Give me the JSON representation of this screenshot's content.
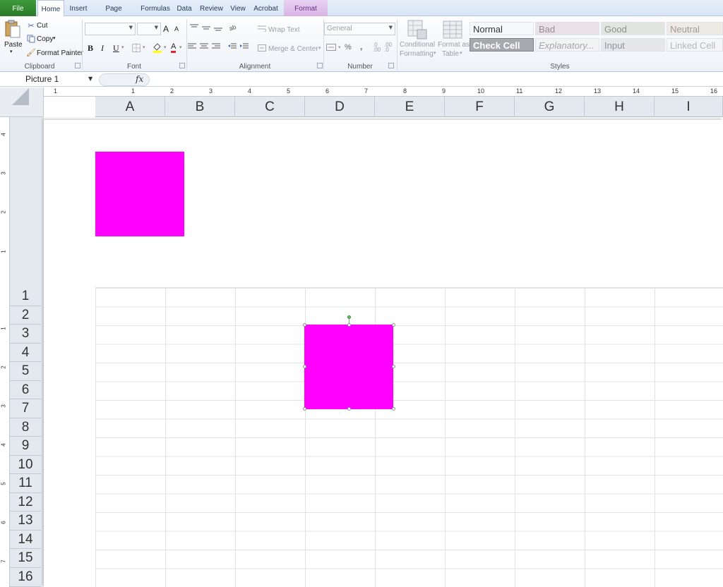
{
  "tabs": {
    "file": "File",
    "home": "Home",
    "insert": "Insert",
    "page_layout": "Page Layout",
    "formulas": "Formulas",
    "data": "Data",
    "review": "Review",
    "view": "View",
    "acrobat": "Acrobat",
    "format": "Format"
  },
  "clipboard": {
    "paste": "Paste",
    "cut": "Cut",
    "copy": "Copy",
    "format_painter": "Format Painter",
    "group_label": "Clipboard"
  },
  "font": {
    "bold": "B",
    "italic": "I",
    "underline": "U",
    "grow": "A",
    "shrink": "A",
    "font_color_letter": "A",
    "group_label": "Font"
  },
  "alignment": {
    "wrap_text": "Wrap Text",
    "merge_center": "Merge & Center",
    "group_label": "Alignment"
  },
  "number": {
    "format_value": "General",
    "percent": "%",
    "comma": ",",
    "increase_decimal": ".0 .00",
    "decrease_decimal": ".00 .0",
    "group_label": "Number"
  },
  "styles": {
    "conditional_formatting_1": "Conditional",
    "conditional_formatting_2": "Formatting",
    "format_as_table_1": "Format as",
    "format_as_table_2": "Table",
    "normal": "Normal",
    "bad": "Bad",
    "good": "Good",
    "neutral": "Neutral",
    "check_cell": "Check Cell",
    "explanatory": "Explanatory...",
    "input": "Input",
    "linked_cell": "Linked Cell",
    "group_label": "Styles"
  },
  "formula_bar": {
    "name_box": "Picture 1",
    "fx": "fx"
  },
  "ruler_top": [
    "1",
    "1",
    "2",
    "3",
    "4",
    "5",
    "6",
    "7",
    "8",
    "9",
    "10",
    "11",
    "12",
    "13",
    "14",
    "15",
    "16"
  ],
  "ruler_left_header": [
    "4",
    "3",
    "2",
    "1"
  ],
  "ruler_left_body": [
    "1",
    "2",
    "3",
    "4",
    "5",
    "6",
    "7"
  ],
  "columns": [
    "A",
    "B",
    "C",
    "D",
    "E",
    "F",
    "G",
    "H",
    "I"
  ],
  "rows": [
    "1",
    "2",
    "3",
    "4",
    "5",
    "6",
    "7",
    "8",
    "9",
    "10",
    "11",
    "12",
    "13",
    "14",
    "15",
    "16"
  ],
  "colors": {
    "picture_fill": "#ff00ff",
    "file_tab": "#2b7a29",
    "format_tab": "#d8b4e6"
  }
}
